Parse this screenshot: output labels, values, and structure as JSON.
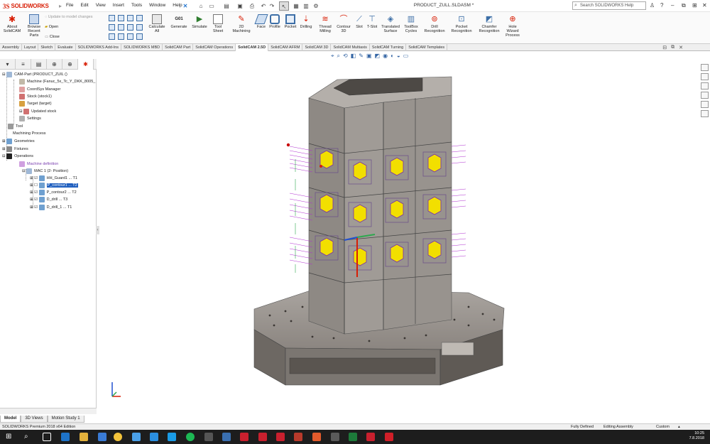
{
  "app": {
    "logo_prefix": "3S",
    "logo_text": "SOLIDWORKS",
    "document_title": "PRODUCT_ZULL.SLDASM *",
    "help_search_placeholder": "Search SOLIDWORKS Help",
    "help_label": "?",
    "menus": [
      "File",
      "Edit",
      "View",
      "Insert",
      "Tools",
      "Window",
      "Help"
    ]
  },
  "ribbon": {
    "about": "About\nSolidCAM",
    "browse": "Browse\nRecent\nParts",
    "update_model": "Update to model changes",
    "open": "Open",
    "close": "Close",
    "calculate_all": "Calculate\nAll",
    "generate": "Generate",
    "simulate": "Simulate",
    "tool_sheet": "Tool\nSheet",
    "machining_2d": "2D\nMachining",
    "face": "Face",
    "profile": "Profile",
    "pocket": "Pocket",
    "drilling": "Drilling",
    "thread_milling": "Thread\nMilling",
    "contour_3d": "Contour\n3D",
    "slot": "Slot",
    "tslot": "T-Slot",
    "translated_surface": "Translated\nSurface",
    "toolbox_cycles": "ToolBox\nCycles",
    "drill_recognition": "Drill\nRecognition",
    "pocket_recognition": "Pocket\nRecognition",
    "chamfer_recognition": "Chamfer\nRecognition",
    "hole_wizard_process": "Hole\nWizard\nProcess"
  },
  "tabs": [
    "Assembly",
    "Layout",
    "Sketch",
    "Evaluate",
    "SOLIDWORKS Add-Ins",
    "SOLIDWORKS MBD",
    "SolidCAM Part",
    "SolidCAM Operations",
    "SolidCAM 2.5D",
    "SolidCAM AFRM",
    "SolidCAM 3D",
    "SolidCAM Multiaxis",
    "SolidCAM Turning",
    "SolidCAM Templates"
  ],
  "active_tab": "SolidCAM 2.5D",
  "tree": {
    "root": "CAM-Part (PRODUCT_ZUIL ()",
    "machine": "Machine (Fanuc_5x_Tc_Y_DKK_8005_",
    "coordsys": "CoordSys Manager",
    "stock": "Stock (stock1)",
    "target": "Target (target)",
    "updated_stock": "Updated stock",
    "settings": "Settings",
    "tool": "Tool",
    "machining_process": "Machining Process",
    "geometries": "Geometries",
    "fixtures": "Fixtures",
    "operations": "Operations",
    "machine_definition": "Machine definition",
    "mac": "MAC 1 (2- Position)",
    "ops": [
      "HH_Guard1 ... T1",
      "P_contour1 ... T2",
      "P_contour2 ... T2",
      "D_drill ... T3",
      "D_drill_1 ... T1"
    ]
  },
  "bottom_tabs": [
    "Model",
    "3D Views",
    "Motion Study 1"
  ],
  "status": {
    "edition": "SOLIDWORKS Premium 2018 x64 Edition",
    "defined": "Fully Defined",
    "mode": "Editing Assembly",
    "units": "Custom"
  },
  "clock": {
    "time": "10:25",
    "date": "7.8.2018"
  },
  "colors": {
    "accent": "#d81e05",
    "selection": "#1f5fbf",
    "taskbar": "#1d1d1d",
    "part_fill": "#8a8580",
    "drill_yellow": "#f2df00"
  }
}
